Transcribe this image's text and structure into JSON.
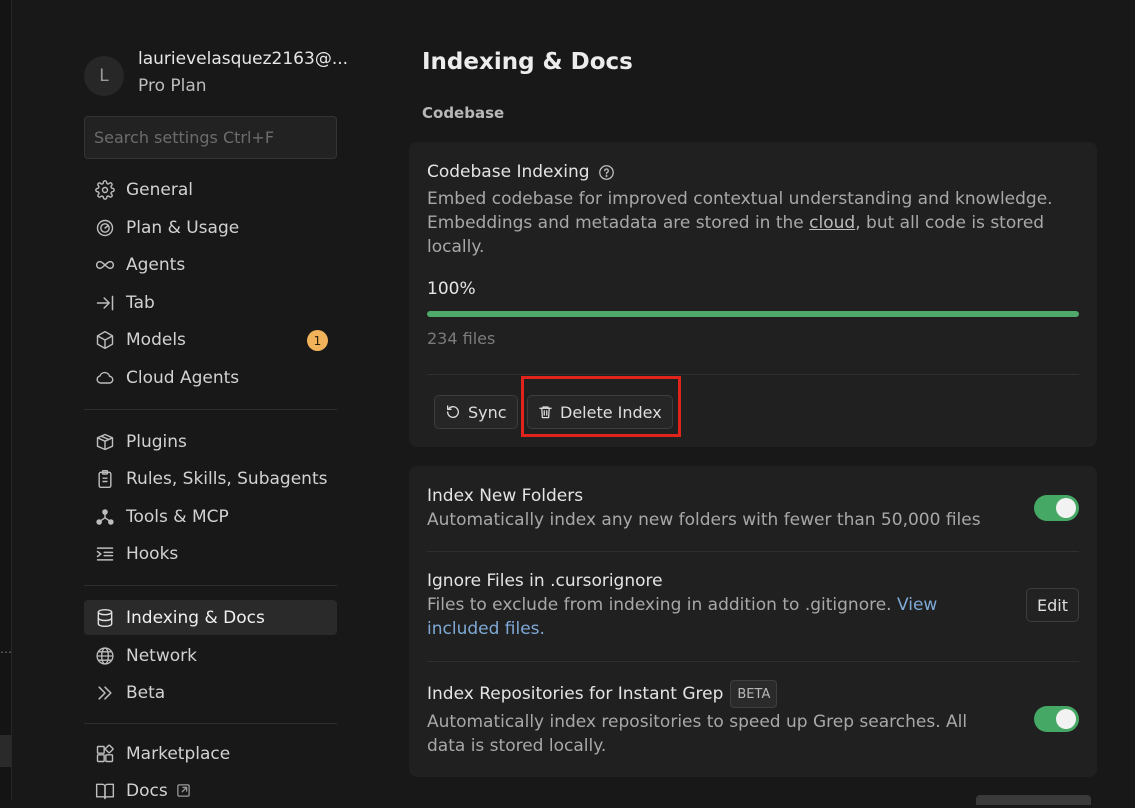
{
  "profile": {
    "initial": "L",
    "email": "laurievelasquez2163@...",
    "plan": "Pro Plan"
  },
  "search": {
    "placeholder": "Search settings Ctrl+F"
  },
  "sidebar": {
    "group1": [
      {
        "label": "General",
        "icon": "gear-icon"
      },
      {
        "label": "Plan & Usage",
        "icon": "gauge-icon"
      },
      {
        "label": "Agents",
        "icon": "infinity-icon"
      },
      {
        "label": "Tab",
        "icon": "arrow-to-line-icon"
      },
      {
        "label": "Models",
        "icon": "cube-icon",
        "badge": "1"
      },
      {
        "label": "Cloud Agents",
        "icon": "cloud-icon"
      }
    ],
    "group2": [
      {
        "label": "Plugins",
        "icon": "package-icon"
      },
      {
        "label": "Rules, Skills, Subagents",
        "icon": "clipboard-icon"
      },
      {
        "label": "Tools & MCP",
        "icon": "nodes-icon"
      },
      {
        "label": "Hooks",
        "icon": "list-indent-icon"
      }
    ],
    "group3": [
      {
        "label": "Indexing & Docs",
        "icon": "database-icon",
        "active": true
      },
      {
        "label": "Network",
        "icon": "globe-icon"
      },
      {
        "label": "Beta",
        "icon": "double-chevron-icon"
      }
    ],
    "group4": [
      {
        "label": "Marketplace",
        "icon": "blocks-icon"
      },
      {
        "label": "Docs",
        "icon": "book-icon"
      }
    ]
  },
  "main": {
    "title": "Indexing & Docs",
    "section": "Codebase",
    "indexing": {
      "title": "Codebase Indexing",
      "desc_before": "Embed codebase for improved contextual understanding and knowledge. Embeddings and metadata are stored in the ",
      "desc_link": "cloud",
      "desc_after": ", but all code is stored locally.",
      "progress_label": "100%",
      "progress_value": 1.0,
      "files": "234 files",
      "sync_label": "Sync",
      "delete_label": "Delete Index"
    },
    "settings": {
      "new_folders": {
        "title": "Index New Folders",
        "desc": "Automatically index any new folders with fewer than 50,000 files",
        "enabled": true
      },
      "ignore": {
        "title": "Ignore Files in .cursorignore",
        "desc": "Files to exclude from indexing in addition to .gitignore. ",
        "link": "View included files.",
        "edit_label": "Edit"
      },
      "repos": {
        "title": "Index Repositories for Instant Grep",
        "badge": "BETA",
        "desc": "Automatically index repositories to speed up Grep searches. All data is stored locally.",
        "enabled": true
      }
    }
  },
  "colors": {
    "accent_green": "#46a865",
    "highlight_red": "#e0241b",
    "badge_orange": "#f0b25a",
    "link_blue": "#7fa9d6"
  }
}
